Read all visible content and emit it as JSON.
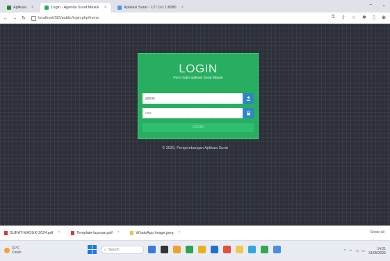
{
  "browser": {
    "tabs": [
      {
        "label": "Aplikasi",
        "favicon_color": "#2e7d32",
        "active": false
      },
      {
        "label": "Login - Agenda Surat Masuk",
        "favicon_color": "#27ae60",
        "active": true
      },
      {
        "label": "Aplikasi Surat - 127.0.0.1:8080",
        "favicon_color": "#5b8def",
        "active": false
      }
    ],
    "address": "localhost/SIS/public/login.php/home"
  },
  "login": {
    "title": "LOGIN",
    "subtitle": "Form login aplikasi Surat Masuk",
    "username_value": "admin",
    "password_value": "•••••",
    "button_label": "LOGIN",
    "card_color": "#27ae60",
    "addon_color": "#2e86c8"
  },
  "copyright": "© 2025, Pengembangan Aplikasi Surat",
  "downloads": {
    "items": [
      {
        "label": "SURAT-MASUK-2024.pdf",
        "kind": "pdf"
      },
      {
        "label": "Template-laporan.pdf",
        "kind": "pdf"
      },
      {
        "label": "WhatsApp Image.jpeg",
        "kind": "image"
      }
    ],
    "show_all": "Show all"
  },
  "taskbar": {
    "weather_temp": "31°C",
    "weather_desc": "Cerah",
    "search_placeholder": "Search",
    "apps": [
      "#3a7bd5",
      "#333333",
      "#f0a030",
      "#2ea44f",
      "#e8b020",
      "#1f6fd1",
      "#e0503a",
      "#f2c94c",
      "#31a8e0",
      "#34a853",
      "#4a90e2"
    ],
    "time": "14:21",
    "date": "31/05/2025"
  }
}
